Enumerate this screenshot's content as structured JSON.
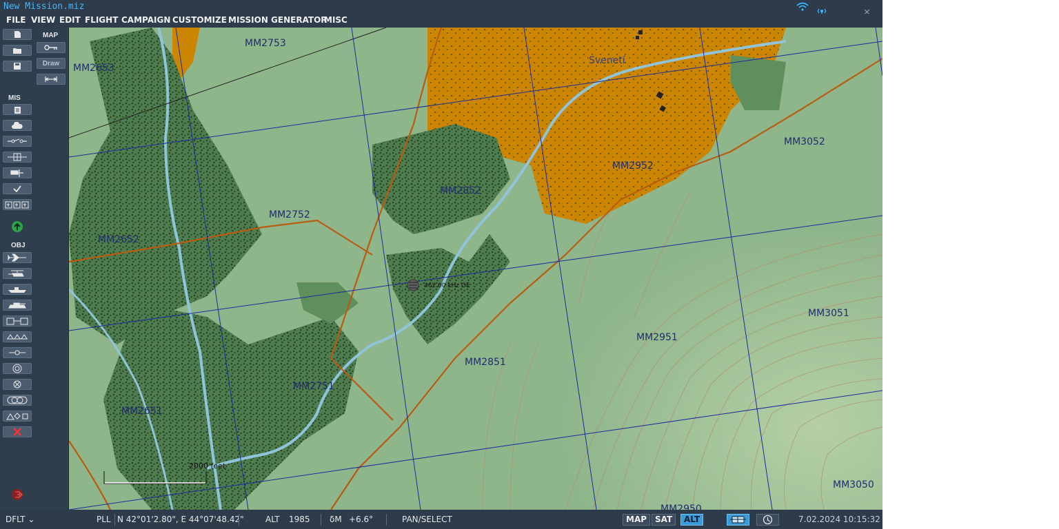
{
  "window": {
    "title": "New Mission.miz"
  },
  "menu": [
    "FILE",
    "VIEW",
    "EDIT",
    "FLIGHT",
    "CAMPAIGN",
    "CUSTOMIZE",
    "MISSION GENERATOR",
    "MISC"
  ],
  "sidebar": {
    "map_label": "MAP",
    "draw_label": "Draw",
    "mis_label": "MIS",
    "obj_label": "OBJ"
  },
  "map": {
    "grid_labels": [
      "MM2653",
      "MM2753",
      "MM2652",
      "MM2752",
      "MM2852",
      "MM2952",
      "MM3052",
      "MM2651",
      "MM2751",
      "MM2851",
      "MM2951",
      "MM3051",
      "MM3050",
      "MM2950"
    ],
    "town_name": "Svenetí",
    "beacon_label": "462.00 kHz OE",
    "scale_label": "2000 feet"
  },
  "status": {
    "profile": "DFLT",
    "coord_type": "PLL",
    "coordinates": "N 42°01'2.80\", E 44°07'48.42\"",
    "alt_label": "ALT",
    "alt_value": "1985",
    "delta_label": "δM",
    "delta_value": "+6.6°",
    "mode": "PAN/SELECT",
    "map_btn": "MAP",
    "sat_btn": "SAT",
    "alt_btn": "ALT",
    "datetime": "7.02.2024 10:15:32"
  },
  "colors": {
    "accent": "#3fb8ff",
    "town": "#cc8500",
    "forest": "#5a8a5a",
    "road": "#b85c10",
    "river": "#8fc4da",
    "grid": "#1b2b9a",
    "terrain": "#8fb58b"
  }
}
